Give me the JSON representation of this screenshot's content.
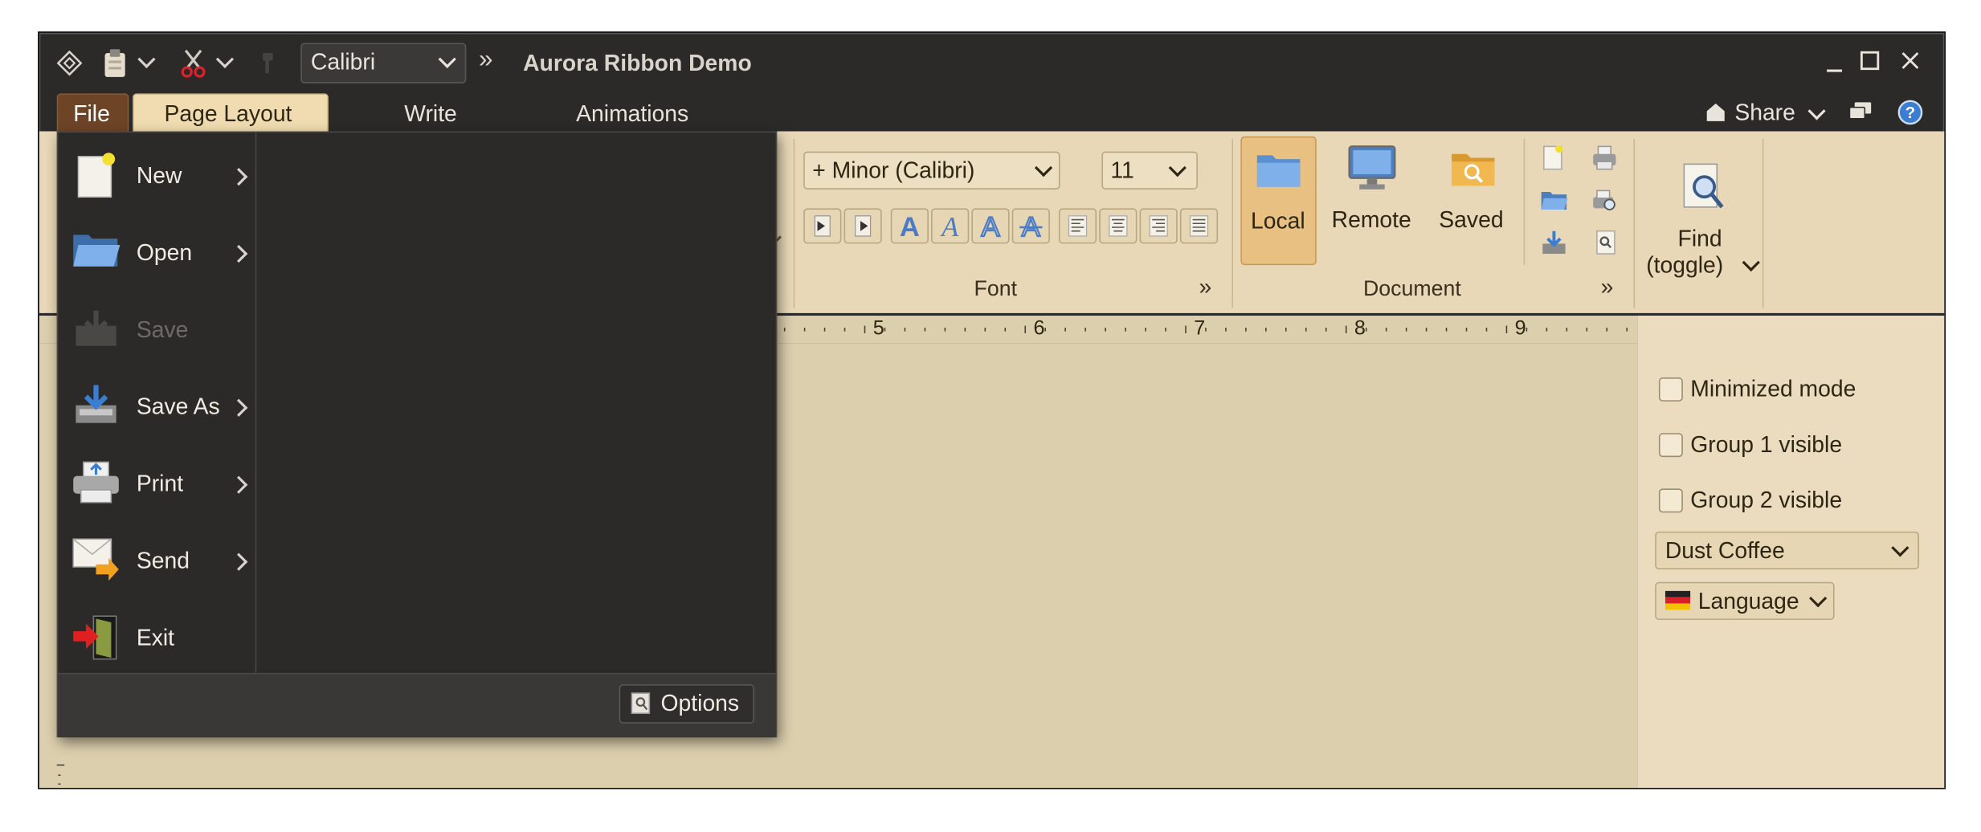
{
  "titlebar": {
    "font_combo": "Calibri",
    "title": "Aurora Ribbon Demo",
    "overflow_glyph": "»"
  },
  "tabs": {
    "file": "File",
    "page_layout": "Page Layout",
    "write": "Write",
    "animations": "Animations",
    "share": "Share"
  },
  "ribbon": {
    "font_family": "+ Minor (Calibri)",
    "font_size": "11",
    "font_group": "Font",
    "document_group": "Document",
    "local": "Local",
    "remote": "Remote",
    "saved": "Saved",
    "find_line1": "Find",
    "find_line2": "(toggle)"
  },
  "ruler": {
    "marks": [
      "5",
      "6",
      "7",
      "8",
      "9"
    ]
  },
  "file_menu": {
    "items": [
      {
        "label": "New",
        "enabled": true,
        "submenu": true
      },
      {
        "label": "Open",
        "enabled": true,
        "submenu": true
      },
      {
        "label": "Save",
        "enabled": false,
        "submenu": false
      },
      {
        "label": "Save As",
        "enabled": true,
        "submenu": true
      },
      {
        "label": "Print",
        "enabled": true,
        "submenu": true
      },
      {
        "label": "Send",
        "enabled": true,
        "submenu": true
      },
      {
        "label": "Exit",
        "enabled": true,
        "submenu": false
      }
    ],
    "options": "Options"
  },
  "panel": {
    "minimized_mode": "Minimized mode",
    "group1_visible": "Group 1 visible",
    "group2_visible": "Group 2 visible",
    "skin": "Dust Coffee",
    "language": "Language"
  },
  "colors": {
    "ribbon_bg": "#e8d8b8",
    "doc_bg": "#dccfad",
    "menu_bg": "#2b2a28",
    "file_tab": "#6e4426",
    "selected_tab": "#f0dcb0",
    "local_selected": "#e8c082"
  }
}
